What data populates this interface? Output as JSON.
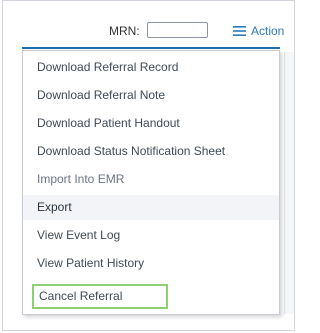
{
  "toolbar": {
    "mrn_label": "MRN:",
    "mrn_value": "",
    "actions_label": "Action",
    "actions_icon": "hamburger-menu-icon"
  },
  "menu": {
    "items": [
      {
        "label": "Download Referral Record"
      },
      {
        "label": "Download Referral Note"
      },
      {
        "label": "Download Patient Handout"
      },
      {
        "label": "Download Status Notification Sheet"
      },
      {
        "label": "Import Into EMR",
        "state": "disabled"
      },
      {
        "label": "Export",
        "state": "hovered"
      },
      {
        "label": "View Event Log"
      },
      {
        "label": "View Patient History"
      },
      {
        "label": "Cancel Referral",
        "state": "highlighted"
      }
    ],
    "highlight_color": "#8fcf73"
  },
  "colors": {
    "accent": "#2e79b8",
    "text": "#3f4a56"
  }
}
